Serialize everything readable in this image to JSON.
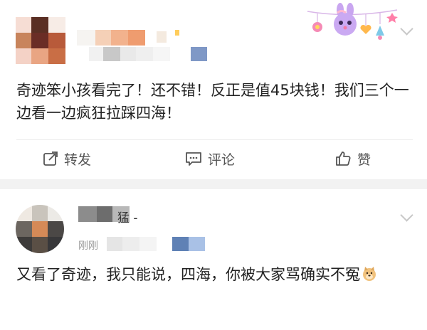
{
  "post1": {
    "text": "奇迹笨小孩看完了！还不错！反正是值45块钱！我们三个一边看一边疯狂拉踩四海！",
    "actions": {
      "repost": "转发",
      "comment": "评论",
      "like": "赞"
    }
  },
  "post2": {
    "username_fragment": "猛 -",
    "time_fragment": "刚刚",
    "text": "又看了奇迹，我只能说，四海，你被大家骂确实不冤"
  },
  "icons": {
    "expand": "chevron-down-icon",
    "repost": "share-icon",
    "comment": "comment-icon",
    "like": "thumbs-up-icon",
    "emoji": "doge-emoji-icon",
    "decoration": "bunny-decoration-icon"
  }
}
